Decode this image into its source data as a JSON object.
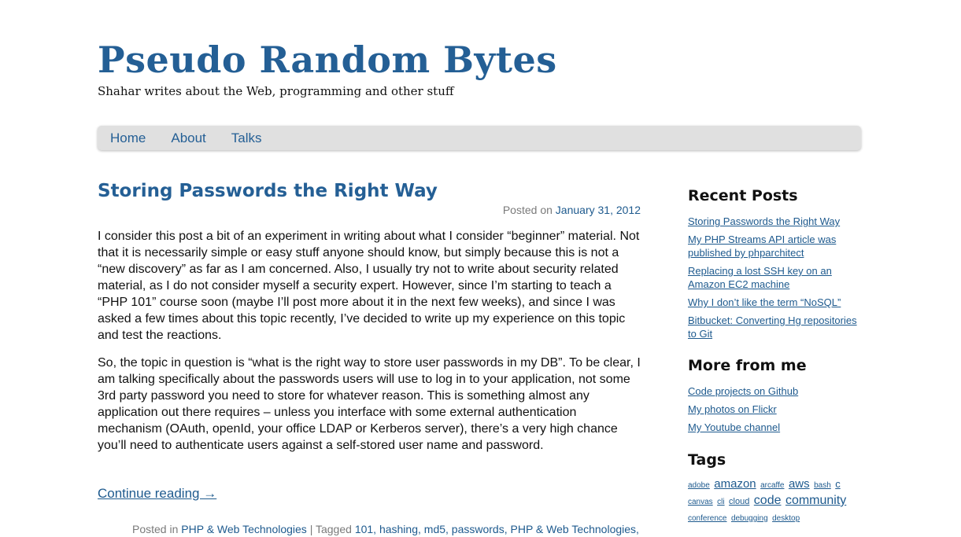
{
  "site": {
    "title": "Pseudo Random Bytes",
    "description": "Shahar writes about the Web, programming and other stuff"
  },
  "nav": [
    {
      "label": "Home"
    },
    {
      "label": "About"
    },
    {
      "label": "Talks"
    }
  ],
  "post": {
    "title": "Storing Passwords the Right Way",
    "posted_on_label": "Posted on",
    "date": "January 31, 2012",
    "paragraphs": [
      "I consider this post a bit of an experiment in writing about what I consider “beginner” material. Not that it is necessarily simple or easy stuff anyone should know, but simply because this is not a “new discovery” as far as I am concerned. Also, I usually try not to write about security related material, as I do not consider myself a security expert. However, since I’m starting to teach a “PHP 101” course soon (maybe I’ll post more about it in the next few weeks), and since I was asked a few times about this topic recently, I’ve decided to write up my experience on this topic and test the reactions.",
      "So, the topic in question is “what is the right way to store user passwords in my DB”. To be clear, I am talking specifically about the passwords users will use to log in to your application, not some 3rd party password you need to store for whatever reason. This is something almost any application out there requires – unless you interface with some external authentication mechanism (OAuth, openId, your office LDAP or Kerberos server), there’s a very high chance you’ll need to authenticate users against a self-stored user name and password."
    ],
    "continue_label": "Continue reading →",
    "footer": {
      "posted_in_label": "Posted in",
      "category": "PHP & Web Technologies",
      "separator": "|",
      "tagged_label": "Tagged",
      "tags": [
        "101,",
        "hashing,",
        "md5,",
        "passwords,",
        "PHP & Web Technologies,"
      ]
    }
  },
  "sidebar": {
    "recent_posts": {
      "title": "Recent Posts",
      "items": [
        {
          "label": "Storing Passwords the Right Way"
        },
        {
          "label": "My PHP Streams API article was published by phparchitect"
        },
        {
          "label": "Replacing a lost SSH key on an Amazon EC2 machine"
        },
        {
          "label": "Why I don’t like the term “NoSQL”"
        },
        {
          "label": "Bitbucket: Converting Hg repositories to Git"
        }
      ]
    },
    "more_from_me": {
      "title": "More from me",
      "items": [
        {
          "label": "Code projects on Github"
        },
        {
          "label": "My photos on Flickr"
        },
        {
          "label": "My Youtube channel"
        }
      ]
    },
    "tags": {
      "title": "Tags",
      "items": [
        {
          "label": "adobe",
          "size": "xs"
        },
        {
          "label": "amazon",
          "size": "lg"
        },
        {
          "label": "arcaffe",
          "size": "xs"
        },
        {
          "label": "aws",
          "size": "lg"
        },
        {
          "label": "bash",
          "size": "xs"
        },
        {
          "label": "c",
          "size": "md"
        },
        {
          "label": "canvas",
          "size": "xs"
        },
        {
          "label": "cli",
          "size": "xs"
        },
        {
          "label": "cloud",
          "size": "sm"
        },
        {
          "label": "code",
          "size": "xl"
        },
        {
          "label": "community",
          "size": "xl"
        },
        {
          "label": "conference",
          "size": "xs"
        },
        {
          "label": "debugging",
          "size": "xs"
        },
        {
          "label": "desktop",
          "size": "xs"
        }
      ]
    }
  },
  "colors": {
    "title_blue": "#245f95",
    "link_blue": "#1e5a8e",
    "nav_bg": "#e0e0e0",
    "meta_gray": "#7a7a7a"
  }
}
